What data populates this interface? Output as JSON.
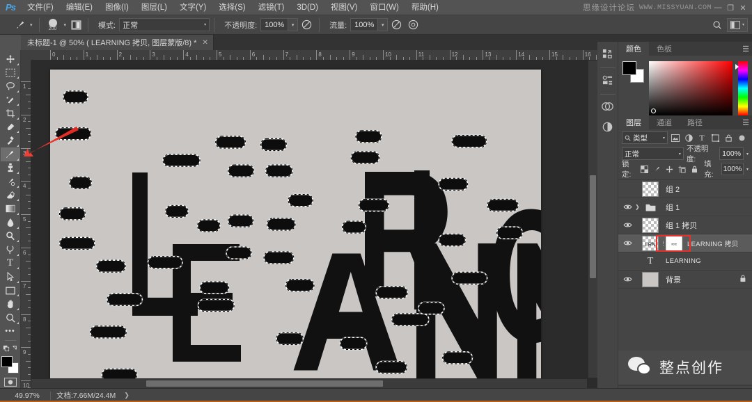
{
  "app": {
    "logo": "Ps",
    "watermark_top_cn": "思缘设计论坛",
    "watermark_top_en": "WWW.MISSYUAN.COM",
    "win_minimize": "—",
    "win_restore": "❐",
    "win_close": "✕"
  },
  "menubar": {
    "items": [
      {
        "label": "文件(F)"
      },
      {
        "label": "编辑(E)"
      },
      {
        "label": "图像(I)"
      },
      {
        "label": "图层(L)"
      },
      {
        "label": "文字(Y)"
      },
      {
        "label": "选择(S)"
      },
      {
        "label": "滤镜(T)"
      },
      {
        "label": "3D(D)"
      },
      {
        "label": "视图(V)"
      },
      {
        "label": "窗口(W)"
      },
      {
        "label": "帮助(H)"
      }
    ]
  },
  "optionsbar": {
    "brush_icon": "brush-tool-icon",
    "brush_size": "200",
    "brush_preset_icon": "brush-panel-icon",
    "mode_label": "模式:",
    "mode_value": "正常",
    "opacity_label": "不透明度:",
    "opacity_value": "100%",
    "pressure_opacity_icon": "pressure-opacity-icon",
    "flow_label": "流量:",
    "flow_value": "100%",
    "airbrush_icon": "airbrush-icon",
    "smoothing_icon": "smoothing-icon",
    "search_icon": "search-icon",
    "workspace_icon": "workspace-switcher-icon"
  },
  "tab": {
    "title": "未标题-1 @ 50% ( LEARNING 拷贝, 图层蒙版/8) *",
    "close": "✕"
  },
  "toolbar": {
    "tools": [
      {
        "name": "move-tool",
        "glyph": "✥",
        "active": false
      },
      {
        "name": "marquee-tool",
        "glyph": "▭",
        "active": false
      },
      {
        "name": "lasso-tool",
        "glyph": "◯",
        "active": false
      },
      {
        "name": "quick-selection-tool",
        "glyph": "✎",
        "active": false
      },
      {
        "name": "crop-tool",
        "glyph": "⌗",
        "active": false
      },
      {
        "name": "eyedropper-tool",
        "glyph": "✒",
        "active": false
      },
      {
        "name": "healing-brush-tool",
        "glyph": "✚",
        "active": false
      },
      {
        "name": "brush-tool",
        "glyph": "✏",
        "active": true
      },
      {
        "name": "clone-stamp-tool",
        "glyph": "♣",
        "active": false
      },
      {
        "name": "history-brush-tool",
        "glyph": "✐",
        "active": false
      },
      {
        "name": "eraser-tool",
        "glyph": "◤",
        "active": false
      },
      {
        "name": "gradient-tool",
        "glyph": "▤",
        "active": false
      },
      {
        "name": "blur-tool",
        "glyph": "💧",
        "active": false
      },
      {
        "name": "dodge-tool",
        "glyph": "◉",
        "active": false
      },
      {
        "name": "pen-tool",
        "glyph": "✑",
        "active": false
      },
      {
        "name": "type-tool",
        "glyph": "T",
        "active": false
      },
      {
        "name": "path-selection-tool",
        "glyph": "➤",
        "active": false
      },
      {
        "name": "rectangle-tool",
        "glyph": "▢",
        "active": false
      },
      {
        "name": "hand-tool",
        "glyph": "✋",
        "active": false
      },
      {
        "name": "zoom-tool",
        "glyph": "🔍",
        "active": false
      },
      {
        "name": "edit-toolbar",
        "glyph": "•••",
        "active": false
      }
    ],
    "foreground_color": "#000000",
    "background_color": "#ffffff",
    "quickmask_icon": "quick-mask-icon"
  },
  "ruler": {
    "h_labels": [
      "0",
      "1",
      "2",
      "3",
      "4",
      "5",
      "6",
      "7",
      "8",
      "9",
      "10",
      "11",
      "12",
      "13",
      "14",
      "15",
      "16"
    ],
    "v_labels": [
      "1",
      "2",
      "3",
      "4",
      "5",
      "6",
      "7",
      "8",
      "9",
      "10"
    ]
  },
  "canvas": {
    "artwork_text": "LEARNING",
    "artwork_description": "distressed LEARNING text with selection marching ants",
    "background_color": "#c9c6c3",
    "text_color": "#0d0d0d"
  },
  "statusbar": {
    "zoom": "49.97%",
    "doc_label": "文档:7.66M/24.4M",
    "arrow": "❯"
  },
  "dock": {
    "icons": [
      {
        "name": "history-panel-icon",
        "glyph": "⎘"
      },
      {
        "name": "properties-panel-icon",
        "glyph": "▤"
      },
      {
        "name": "cc-libraries-icon",
        "glyph": "◎"
      },
      {
        "name": "adjustments-panel-icon",
        "glyph": "◑"
      }
    ]
  },
  "color_panel": {
    "tabs": [
      {
        "label": "颜色",
        "active": true
      },
      {
        "label": "色板",
        "active": false
      }
    ],
    "menu_icon": "panel-menu-icon",
    "foreground": "#000000",
    "background": "#ffffff",
    "picker_hue": "#ff0000"
  },
  "layers_panel": {
    "tabs": [
      {
        "label": "图层",
        "active": true
      },
      {
        "label": "通道",
        "active": false
      },
      {
        "label": "路径",
        "active": false
      }
    ],
    "menu_icon": "panel-menu-icon",
    "filter": {
      "search_icon": "search-icon",
      "kind_label": "类型",
      "icons": [
        {
          "name": "filter-pixel-icon",
          "glyph": "▣"
        },
        {
          "name": "filter-adjustment-icon",
          "glyph": "◑"
        },
        {
          "name": "filter-type-icon",
          "glyph": "T"
        },
        {
          "name": "filter-shape-icon",
          "glyph": "▱"
        },
        {
          "name": "filter-smart-object-icon",
          "glyph": "▥"
        }
      ],
      "toggle_icon": "filter-toggle-icon"
    },
    "blend_mode": "正常",
    "opacity_label": "不透明度:",
    "opacity_value": "100%",
    "lock_label": "锁定:",
    "lock_icons": [
      {
        "name": "lock-transparent-pixels-icon",
        "glyph": "▨"
      },
      {
        "name": "lock-image-pixels-icon",
        "glyph": "✎"
      },
      {
        "name": "lock-position-icon",
        "glyph": "✥"
      },
      {
        "name": "lock-artboard-nesting-icon",
        "glyph": "⌗"
      },
      {
        "name": "lock-all-icon",
        "glyph": "🔒"
      }
    ],
    "fill_label": "填充:",
    "fill_value": "100%",
    "layers": [
      {
        "name": "组 2",
        "visible": false,
        "type": "group-empty",
        "selected": false,
        "locked": false,
        "expander": false
      },
      {
        "name": "组 1",
        "visible": true,
        "type": "folder",
        "selected": false,
        "locked": false,
        "expander": true
      },
      {
        "name": "组 1 拷贝",
        "visible": true,
        "type": "transparent",
        "selected": false,
        "locked": false,
        "expander": false
      },
      {
        "name": "LEARNING 拷贝",
        "visible": true,
        "type": "masked",
        "selected": true,
        "locked": false,
        "expander": false
      },
      {
        "name": "LEARNING",
        "visible": false,
        "type": "text",
        "selected": false,
        "locked": false,
        "expander": false
      },
      {
        "name": "背景",
        "visible": true,
        "type": "solid",
        "selected": false,
        "locked": true,
        "expander": false
      }
    ],
    "footer_icons": [
      {
        "name": "link-layers-icon",
        "glyph": "⚭"
      },
      {
        "name": "layer-style-fx-icon",
        "glyph": "fx"
      },
      {
        "name": "add-layer-mask-icon",
        "glyph": "▣"
      },
      {
        "name": "new-adjustment-layer-icon",
        "glyph": "◑"
      },
      {
        "name": "new-group-icon",
        "glyph": "▰"
      },
      {
        "name": "new-layer-icon",
        "glyph": "⊡"
      },
      {
        "name": "delete-layer-icon",
        "glyph": "🗑"
      }
    ]
  },
  "watermark_wechat": {
    "icon": "wechat-icon",
    "label": "整点创作"
  },
  "annotation": {
    "arrow_color": "#e8302a",
    "target": "brush-tool",
    "highlight_box_color": "#e8302a",
    "highlight_target": "layer-mask-thumbnail"
  }
}
